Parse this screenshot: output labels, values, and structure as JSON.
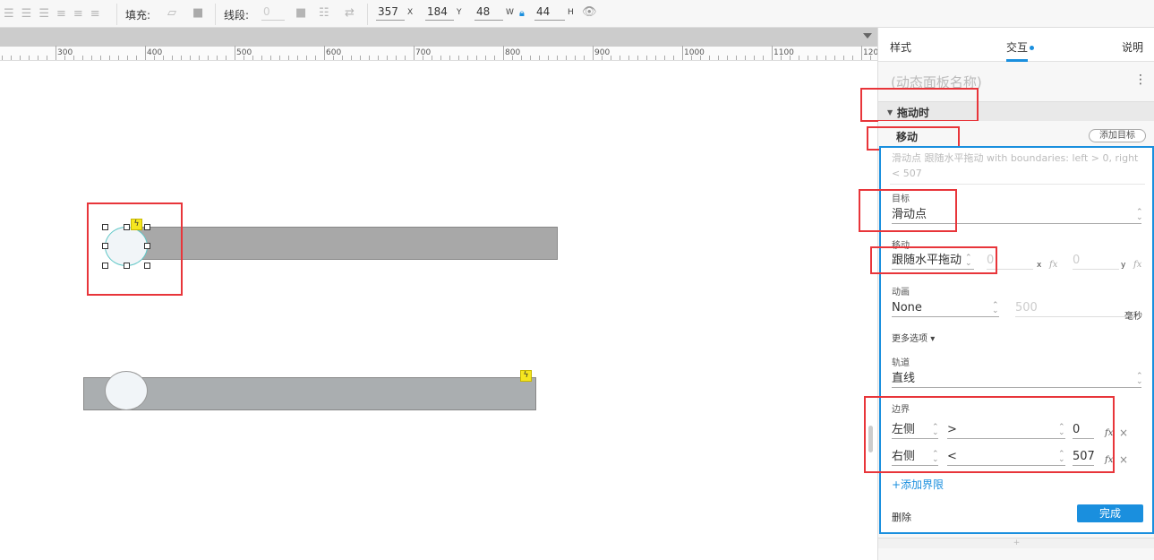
{
  "toolbar": {
    "fill_label": "填充:",
    "stroke_label": "线段:",
    "stroke_value": "0",
    "x_value": "357",
    "x_unit": "X",
    "y_value": "184",
    "y_unit": "Y",
    "w_value": "48",
    "w_unit": "W",
    "h_value": "44",
    "h_unit": "H"
  },
  "ruler": {
    "labels": [
      "300",
      "400",
      "500",
      "600",
      "700",
      "800",
      "900",
      "1000",
      "1100",
      "120"
    ]
  },
  "panel": {
    "tabs": [
      "样式",
      "交互",
      "说明"
    ],
    "title_placeholder": "(动态面板名称)",
    "event": "拖动时",
    "action": "移动",
    "add_target": "添加目标",
    "description": "滑动点 跟随水平拖动  with boundaries: left > 0, right < 507",
    "target_label": "目标",
    "target_value": "滑动点",
    "move_label": "移动",
    "move_value": "跟随水平拖动",
    "move_x": "0",
    "x_unit": "x",
    "move_y": "0",
    "y_unit": "y",
    "anim_label": "动画",
    "anim_value": "None",
    "anim_ms": "500",
    "ms_unit": "毫秒",
    "more_options": "更多选项",
    "track_label": "轨道",
    "track_value": "直线",
    "boundary_label": "边界",
    "boundaries": [
      {
        "side": "左侧",
        "op": ">",
        "value": "0"
      },
      {
        "side": "右侧",
        "op": "<",
        "value": "507"
      }
    ],
    "add_boundary": "+添加界限",
    "delete": "删除",
    "done": "完成"
  },
  "colors": {
    "accent": "#1a8fde",
    "highlight": "#e8353a",
    "selection_bolt": "#f5e61f"
  }
}
